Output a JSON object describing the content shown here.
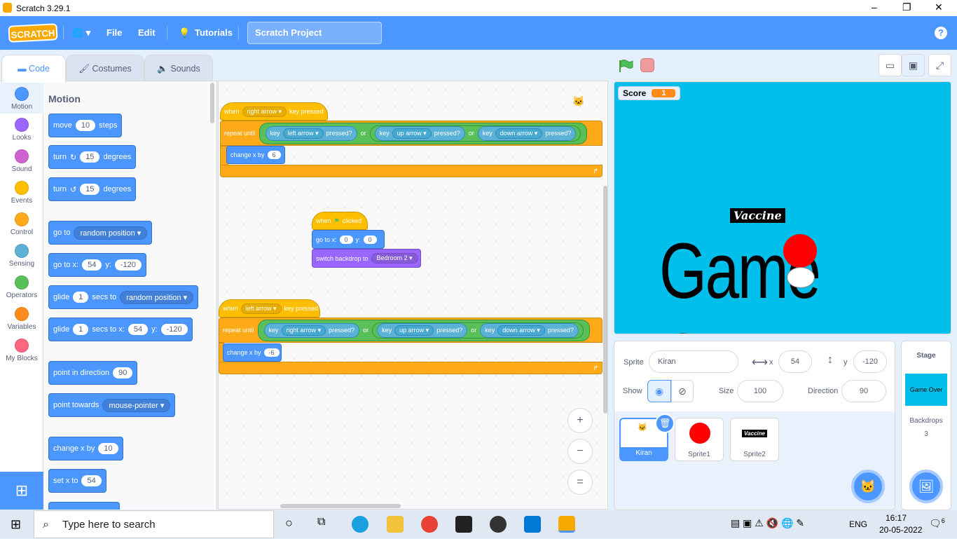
{
  "window": {
    "title": "Scratch 3.29.1",
    "min": "–",
    "max": "❐",
    "close": "✕"
  },
  "menu": {
    "logo": "SCRATCH",
    "globe": "🌐 ▾",
    "file": "File",
    "edit": "Edit",
    "tutorials": "Tutorials",
    "project_title": "Scratch Project",
    "help": "?"
  },
  "tabs": {
    "code": "Code",
    "costumes": "Costumes",
    "sounds": "Sounds"
  },
  "categories": [
    {
      "label": "Motion",
      "color": "#4c97ff"
    },
    {
      "label": "Looks",
      "color": "#9966ff"
    },
    {
      "label": "Sound",
      "color": "#cf63cf"
    },
    {
      "label": "Events",
      "color": "#ffbf00"
    },
    {
      "label": "Control",
      "color": "#ffab19"
    },
    {
      "label": "Sensing",
      "color": "#5cb1d6"
    },
    {
      "label": "Operators",
      "color": "#59c059"
    },
    {
      "label": "Variables",
      "color": "#ff8c1a"
    },
    {
      "label": "My Blocks",
      "color": "#ff6680"
    }
  ],
  "palette": {
    "heading": "Motion",
    "move": {
      "a": "move",
      "v": "10",
      "b": "steps"
    },
    "turn_right": {
      "a": "turn",
      "v": "15",
      "b": "degrees"
    },
    "turn_left": {
      "a": "turn",
      "v": "15",
      "b": "degrees"
    },
    "goto": {
      "a": "go to",
      "d": "random position"
    },
    "gotoxy": {
      "a": "go to x:",
      "x": "54",
      "b": "y:",
      "y": "-120"
    },
    "glide1": {
      "a": "glide",
      "v": "1",
      "b": "secs to",
      "d": "random position"
    },
    "glide2": {
      "a": "glide",
      "v": "1",
      "b": "secs to x:",
      "x": "54",
      "c": "y:",
      "y": "-120"
    },
    "point_dir": {
      "a": "point in direction",
      "v": "90"
    },
    "point_towards": {
      "a": "point towards",
      "d": "mouse-pointer"
    },
    "change_x": {
      "a": "change x by",
      "v": "10"
    },
    "set_x": {
      "a": "set x to",
      "v": "54"
    }
  },
  "script1": {
    "when": "when",
    "key": "right arrow",
    "pressed": "key pressed",
    "repeat": "repeat until",
    "k": "key",
    "pr": "pressed?",
    "or": "or",
    "k1": "left arrow",
    "k2": "up arrow",
    "k3": "down arrow",
    "change": "change x by",
    "val": "6"
  },
  "script2": {
    "when": "when",
    "clicked": "clicked",
    "goto": "go to x:",
    "x": "0",
    "y_lbl": "y:",
    "y": "0",
    "switch": "switch backdrop to",
    "backdrop": "Bedroom 2"
  },
  "script3": {
    "when": "when",
    "key": "left arrow",
    "pressed": "key pressed",
    "repeat": "repeat until",
    "k": "key",
    "pr": "pressed?",
    "or": "or",
    "k1": "right arrow",
    "k2": "up arrow",
    "k3": "down arrow",
    "change": "change x by",
    "val": "-6"
  },
  "zoom": {
    "in": "+",
    "out": "−",
    "reset": "="
  },
  "stage": {
    "score_label": "Score",
    "score_value": "1",
    "vaccine": "Vaccine",
    "game_over": "Game Over"
  },
  "sprite_info": {
    "sprite_label": "Sprite",
    "sprite_name": "Kiran",
    "x_label": "x",
    "x": "54",
    "y_label": "y",
    "y": "-120",
    "show_label": "Show",
    "size_label": "Size",
    "size": "100",
    "direction_label": "Direction",
    "direction": "90"
  },
  "sprites": [
    "Kiran",
    "Sprite1",
    "Sprite2"
  ],
  "stage_panel": {
    "title": "Stage",
    "thumb": "Game Over",
    "backdrops_label": "Backdrops",
    "backdrops_count": "3"
  },
  "taskbar": {
    "search": "Type here to search",
    "lang": "ENG",
    "time": "16:17",
    "date": "20-05-2022",
    "notif": "6"
  }
}
